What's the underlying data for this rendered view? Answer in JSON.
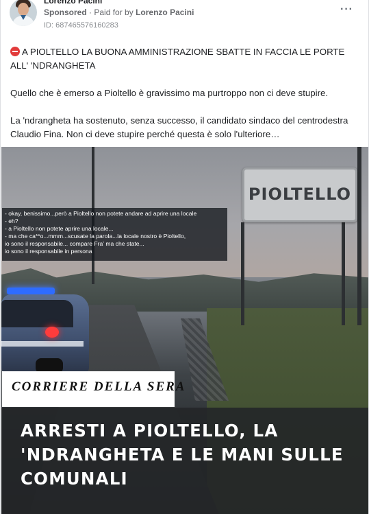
{
  "post": {
    "author": "Lorenzo Pacini",
    "sponsored_label": "Sponsored",
    "paid_for_by_prefix": "Paid for by",
    "paid_for_by_name": "Lorenzo Pacini",
    "ad_id": "ID: 687465576160283",
    "more_icon": "more-horizontal-icon",
    "text_line1": "A PIOLTELLO LA BUONA AMMINISTRAZIONE SBATTE IN FACCIA LE PORTE ALL' 'NDRANGHETA",
    "text_line2": "Quello che è emerso a Pioltello è gravissimo ma purtroppo non ci deve stupire.",
    "text_line3": "La 'ndrangheta ha sostenuto, senza successo, il candidato sindaco del centrodestra Claudio Fina. Non ci deve stupire perché questa è solo l'ulteriore…"
  },
  "media": {
    "sign_text": "PIOLTELLO",
    "transcript": [
      "- okay, benissimo...però a Pioltello non potete andare ad aprire una locale",
      "- eh?",
      "- a Pioltello non potete aprire una locale...",
      "- ma che ca**o...mmm...scusate la parola...la locale nostro è Pioltello,",
      "io sono il responsabile... compare Fra' ma che state...",
      "io sono il responsabile in persona"
    ],
    "source": "CORRIERE DELLA SERA",
    "headline": "ARRESTI A PIOLTELLO, LA 'NDRANGHETA E LE MANI SULLE COMUNALI"
  },
  "colors": {
    "stop_icon": "#e23b3b",
    "headline_bg": "#242628",
    "text_secondary": "#65676b"
  }
}
